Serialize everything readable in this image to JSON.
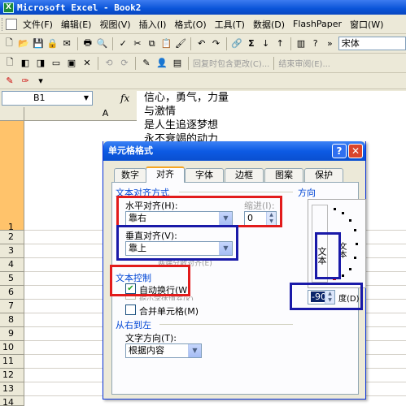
{
  "window": {
    "title": "Microsoft Excel - Book2",
    "app_icon": "X"
  },
  "menu": {
    "items": [
      "文件(F)",
      "编辑(E)",
      "视图(V)",
      "插入(I)",
      "格式(O)",
      "工具(T)",
      "数据(D)",
      "FlashPaper",
      "窗口(W)"
    ]
  },
  "toolbar": {
    "font_name": "宋体",
    "sigma": "Σ"
  },
  "toolbar2": {
    "reply_text": "回复时包含更改(C)...",
    "end_review": "结束审阅(E)..."
  },
  "formula_bar": {
    "name_box": "B1",
    "fx_label": "fx",
    "content_lines": [
      "信心，勇气，力量",
      "与激情",
      "是人生追逐梦想",
      "永不衰竭的动力"
    ]
  },
  "sheet": {
    "column_header": "A",
    "row_numbers": [
      "1",
      "2",
      "3",
      "4",
      "5",
      "6",
      "7",
      "8",
      "9",
      "10",
      "11",
      "12",
      "13",
      "14"
    ]
  },
  "dialog": {
    "title": "单元格格式",
    "help_label": "?",
    "close_label": "✕",
    "tabs": [
      "数字",
      "对齐",
      "字体",
      "边框",
      "图案",
      "保护"
    ],
    "active_tab": "对齐",
    "alignment_section": "文本对齐方式",
    "horizontal_label": "水平对齐(H):",
    "horizontal_value": "靠右",
    "indent_label": "缩进(I):",
    "indent_value": "0",
    "vertical_label": "垂直对齐(V):",
    "vertical_value": "靠上",
    "distributed_label": "两端分散对齐(E)",
    "text_control_section": "文本控制",
    "wrap_text_label": "自动换行(W)",
    "wrap_text_checked": true,
    "shrink_label": "缩小字体填充(K)",
    "merge_label": "合并单元格(M)",
    "rtl_section": "从右到左",
    "direction_label": "文字方向(T):",
    "direction_value": "根据内容",
    "orientation_section": "方向",
    "orientation_vertical_text": "文本",
    "orientation_rotated_text": "文本",
    "degrees_value": "-90",
    "degrees_label": "度(D)"
  },
  "colors": {
    "annotation_red": "#e21b1b",
    "annotation_blue": "#1a1aa8",
    "selected_row": "#ffc36b"
  }
}
